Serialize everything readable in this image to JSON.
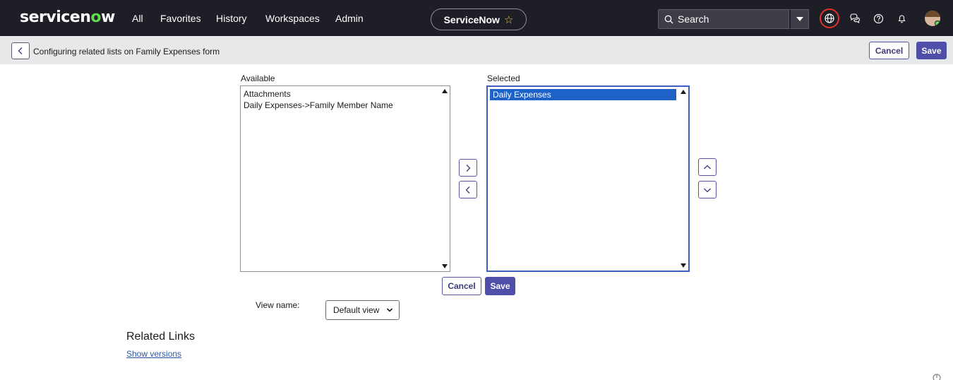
{
  "nav": {
    "logo_text_a": "servicen",
    "logo_text_o": "o",
    "logo_text_b": "w",
    "links": [
      "All",
      "Favorites",
      "History",
      "Workspaces",
      "Admin"
    ],
    "instance_name": "ServiceNow",
    "search_placeholder": "Search",
    "icons": [
      "globe-icon",
      "chat-icon",
      "help-icon",
      "bell-icon",
      "avatar"
    ]
  },
  "form": {
    "title": "Configuring related lists on Family Expenses form",
    "cancel_label": "Cancel",
    "save_label": "Save"
  },
  "slushbucket": {
    "available_label": "Available",
    "selected_label": "Selected",
    "available_items": [
      "Attachments",
      "Daily Expenses->Family Member Name"
    ],
    "selected_items": [
      "Daily Expenses"
    ],
    "selected_highlighted": "Daily Expenses",
    "cancel_label": "Cancel",
    "save_label": "Save"
  },
  "view": {
    "label": "View name:",
    "value": "Default view"
  },
  "related_links": {
    "heading": "Related Links",
    "link": "Show versions"
  },
  "colors": {
    "nav_bg": "#1d1e26",
    "brand_green": "#62d84e",
    "primary": "#4f4ea8",
    "selection": "#1e62c8",
    "alert_red": "#e4312b"
  }
}
